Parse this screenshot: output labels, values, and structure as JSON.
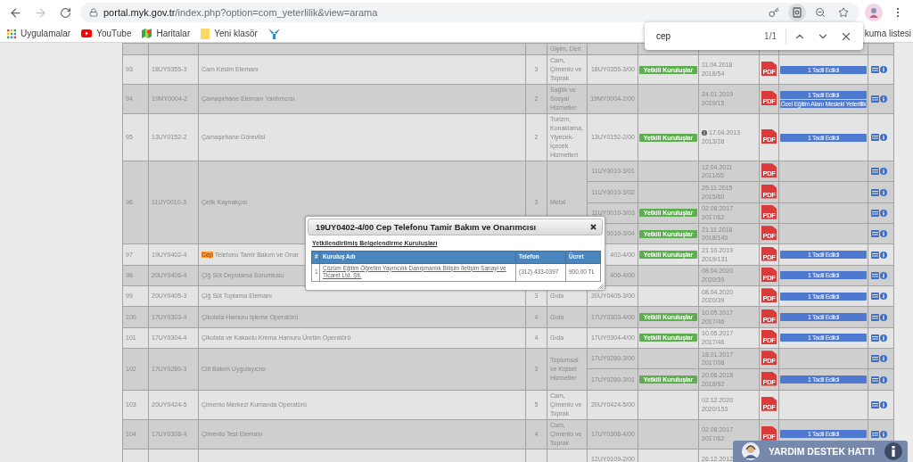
{
  "browser": {
    "url_host": "portal.myk.gov.tr",
    "url_path": "/index.php?option=com_yeterlilik&view=arama"
  },
  "bookmarks": [
    {
      "kind": "apps",
      "label": "Uygulamalar"
    },
    {
      "kind": "youtube",
      "label": "YouTube"
    },
    {
      "kind": "maps",
      "label": "Haritalar"
    },
    {
      "kind": "folder",
      "label": "Yeni klasör"
    },
    {
      "kind": "logo"
    }
  ],
  "reading_list": "kuma listesi",
  "find_bar": {
    "query": "cep",
    "count": "1/1"
  },
  "rows": [
    {
      "sector": "Giyim, Deri"
    },
    {
      "no": "93",
      "code": "18UY0355-3",
      "name": "Cam Kesim Elemanı",
      "level": "3",
      "sector": "Cam, Çimento ve Toprak",
      "revisions": [
        {
          "code": "18UY0355-3/00",
          "badge": "Yetkili Kuruluşlar",
          "note": false,
          "date": "11.04.2018",
          "decision": "2018/54",
          "pdf": "PDF",
          "amendments": [
            "1 Tadil Edildi"
          ]
        }
      ]
    },
    {
      "no": "94",
      "code": "19MY0004-2",
      "name": "Çamaşırhane Elemanı Yardımcısı",
      "level": "2",
      "sector": "Sağlık ve Sosyal Hizmetler",
      "revisions": [
        {
          "code": "19MY0004-2/00",
          "note": false,
          "date": "24.01.2019",
          "decision": "2019/15",
          "pdf": "PDF",
          "amendments": [
            "1 Tadil Edildi",
            "Özel Eğitim Alanı Mesleki Yeterlilik"
          ]
        }
      ]
    },
    {
      "no": "95",
      "code": "13UY0152-2",
      "name": "Çamaşırhane Görevlisi",
      "level": "2",
      "sector": "Turizm, Konaklama, Yiyecek-İçecek Hizmetleri",
      "revisions": [
        {
          "code": "13UY0152-2/00",
          "badge": "Yetkili Kuruluşlar",
          "note": true,
          "date": "17.04.2013",
          "decision": "2013/28",
          "pdf": "PDF",
          "amendments": [
            "1 Tadil Edildi"
          ]
        }
      ]
    },
    {
      "no": "96",
      "code": "11UY0010-3",
      "name": "Çelik Kaynakçısı",
      "level": "3",
      "sector": "Metal",
      "revisions": [
        {
          "code": "11UY0010-3/01",
          "note": false,
          "date": "12.04.2011",
          "decision": "2011/65",
          "pdf": "PDF"
        },
        {
          "code": "11UY0010-3/02",
          "note": false,
          "date": "25.11.2015",
          "decision": "2015/60",
          "pdf": "PDF"
        },
        {
          "code": "11UY0010-3/03",
          "badge": "Yetkili Kuruluşlar",
          "note": false,
          "date": "02.08.2017",
          "decision": "2017/62",
          "pdf": "PDF"
        },
        {
          "code": "0010-3/04",
          "badge": "Yetkili Kuruluşlar",
          "note": false,
          "date": "21.11.2018",
          "decision": "2018/143",
          "pdf": "PDF"
        }
      ]
    },
    {
      "no": "97",
      "code": "19UY0402-4",
      "match": "Cep",
      "name": "Telefonu Tamir Bakım ve Onar",
      "revisions": [
        {
          "code": "402-4/00",
          "badge": "Yetkili Kuruluşlar",
          "note": false,
          "date": "21.10.2019",
          "decision": "2019/131",
          "pdf": "PDF",
          "amendments": [
            "1 Tadil Edildi"
          ]
        }
      ]
    },
    {
      "no": "98",
      "code": "20UY0406-4",
      "name": "Çiğ Süt Depolama Sorumlusu",
      "revisions": [
        {
          "code": "406-4/00",
          "note": false,
          "date": "08.04.2020",
          "decision": "2020/39",
          "pdf": "PDF",
          "amendments": [
            "1 Tadil Edildi"
          ]
        }
      ]
    },
    {
      "no": "99",
      "code": "20UY0405-3",
      "name": "Çiğ Süt Toplama Elemanı",
      "level": "3",
      "sector": "Gıda",
      "revisions": [
        {
          "code": "20UY0405-3/00",
          "note": false,
          "date": "08.04.2020",
          "decision": "2020/39",
          "pdf": "PDF",
          "amendments": [
            "1 Tadil Edildi"
          ]
        }
      ]
    },
    {
      "no": "100",
      "code": "17UY0303-4",
      "name": "Çikolata Hamuru İşleme Operatörü",
      "level": "4",
      "sector": "Gıda",
      "revisions": [
        {
          "code": "17UY0303-4/00",
          "badge": "Yetkili Kuruluşlar",
          "note": false,
          "date": "10.05.2017",
          "decision": "2017/46",
          "pdf": "PDF",
          "amendments": [
            "1 Tadil Edildi"
          ]
        }
      ]
    },
    {
      "no": "101",
      "code": "17UY0304-4",
      "name": "Çikolata ve Kakaolu Krema Hamuru Üretim Operatörü",
      "level": "4",
      "sector": "Gıda",
      "revisions": [
        {
          "code": "17UY0304-4/00",
          "badge": "Yetkili Kuruluşlar",
          "note": false,
          "date": "10.05.2017",
          "decision": "2017/46",
          "pdf": "PDF",
          "amendments": [
            "1 Tadil Edildi"
          ]
        }
      ]
    },
    {
      "no": "102",
      "code": "17UY0280-3",
      "name": "Cilt Bakım Uygulayıcısı",
      "level": "3",
      "sector": "Toplumsal ve Kişisel Hizmetler",
      "revisions": [
        {
          "code": "17UY0280-3/00",
          "note": false,
          "date": "18.01.2017",
          "decision": "2017/08",
          "pdf": "PDF"
        },
        {
          "code": "17UY0280-3/01",
          "badge": "Yetkili Kuruluşlar",
          "note": false,
          "date": "20.06.2018",
          "decision": "2018/92",
          "pdf": "PDF",
          "amendments": [
            "1 Tadil Edildi"
          ]
        }
      ]
    },
    {
      "no": "103",
      "code": "20UY0424-5",
      "name": "Çimento Merkezi Kumanda Operatörü",
      "level": "5",
      "sector": "Cam, Çimento ve Toprak",
      "revisions": [
        {
          "code": "20UY0424-5/00",
          "note": false,
          "date": "02.12.2020",
          "decision": "2020/153",
          "pdf": "PDF"
        }
      ]
    },
    {
      "no": "104",
      "code": "17UY0308-4",
      "name": "Çimento Test Elemanı",
      "level": "4",
      "sector": "Cam, Çimento ve Toprak",
      "revisions": [
        {
          "code": "17UY0308-4/00",
          "note": false,
          "date": "02.08.2017",
          "decision": "2017/62",
          "pdf": "PDF",
          "amendments": [
            "1 Tadil Edildi"
          ]
        }
      ]
    },
    {
      "revisions": [
        {
          "code": "12UY0109-2/00",
          "note": false,
          "date": "26.12.2012"
        }
      ]
    }
  ],
  "dialog": {
    "title": "19UY0402-4/00 Cep Telefonu Tamir Bakım ve Onarımcısı",
    "subtitle": "Yetkilendirilmiş Belgelendirme Kuruluşları",
    "columns": [
      "#",
      "Kuruluş Adı",
      "Telefon",
      "Ücret"
    ],
    "rows": [
      {
        "no": "1",
        "name": "Çözüm Eğitim Öğretim Yayıncılık Danışmanlık Bilişim İletişim Sanayi ve Ticaret Ltd. Şti.",
        "phone": "(312) 433-0397",
        "fee": "900,00 TL"
      }
    ]
  },
  "help": {
    "label": "YARDIM DESTEK HATTI"
  }
}
